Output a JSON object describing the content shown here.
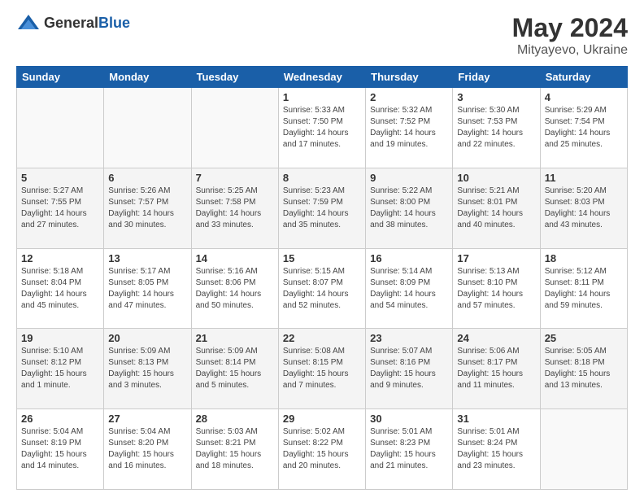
{
  "header": {
    "logo": {
      "general": "General",
      "blue": "Blue"
    },
    "title": "May 2024",
    "location": "Mityayevo, Ukraine"
  },
  "days_of_week": [
    "Sunday",
    "Monday",
    "Tuesday",
    "Wednesday",
    "Thursday",
    "Friday",
    "Saturday"
  ],
  "weeks": [
    [
      {
        "day": "",
        "info": ""
      },
      {
        "day": "",
        "info": ""
      },
      {
        "day": "",
        "info": ""
      },
      {
        "day": "1",
        "info": "Sunrise: 5:33 AM\nSunset: 7:50 PM\nDaylight: 14 hours\nand 17 minutes."
      },
      {
        "day": "2",
        "info": "Sunrise: 5:32 AM\nSunset: 7:52 PM\nDaylight: 14 hours\nand 19 minutes."
      },
      {
        "day": "3",
        "info": "Sunrise: 5:30 AM\nSunset: 7:53 PM\nDaylight: 14 hours\nand 22 minutes."
      },
      {
        "day": "4",
        "info": "Sunrise: 5:29 AM\nSunset: 7:54 PM\nDaylight: 14 hours\nand 25 minutes."
      }
    ],
    [
      {
        "day": "5",
        "info": "Sunrise: 5:27 AM\nSunset: 7:55 PM\nDaylight: 14 hours\nand 27 minutes."
      },
      {
        "day": "6",
        "info": "Sunrise: 5:26 AM\nSunset: 7:57 PM\nDaylight: 14 hours\nand 30 minutes."
      },
      {
        "day": "7",
        "info": "Sunrise: 5:25 AM\nSunset: 7:58 PM\nDaylight: 14 hours\nand 33 minutes."
      },
      {
        "day": "8",
        "info": "Sunrise: 5:23 AM\nSunset: 7:59 PM\nDaylight: 14 hours\nand 35 minutes."
      },
      {
        "day": "9",
        "info": "Sunrise: 5:22 AM\nSunset: 8:00 PM\nDaylight: 14 hours\nand 38 minutes."
      },
      {
        "day": "10",
        "info": "Sunrise: 5:21 AM\nSunset: 8:01 PM\nDaylight: 14 hours\nand 40 minutes."
      },
      {
        "day": "11",
        "info": "Sunrise: 5:20 AM\nSunset: 8:03 PM\nDaylight: 14 hours\nand 43 minutes."
      }
    ],
    [
      {
        "day": "12",
        "info": "Sunrise: 5:18 AM\nSunset: 8:04 PM\nDaylight: 14 hours\nand 45 minutes."
      },
      {
        "day": "13",
        "info": "Sunrise: 5:17 AM\nSunset: 8:05 PM\nDaylight: 14 hours\nand 47 minutes."
      },
      {
        "day": "14",
        "info": "Sunrise: 5:16 AM\nSunset: 8:06 PM\nDaylight: 14 hours\nand 50 minutes."
      },
      {
        "day": "15",
        "info": "Sunrise: 5:15 AM\nSunset: 8:07 PM\nDaylight: 14 hours\nand 52 minutes."
      },
      {
        "day": "16",
        "info": "Sunrise: 5:14 AM\nSunset: 8:09 PM\nDaylight: 14 hours\nand 54 minutes."
      },
      {
        "day": "17",
        "info": "Sunrise: 5:13 AM\nSunset: 8:10 PM\nDaylight: 14 hours\nand 57 minutes."
      },
      {
        "day": "18",
        "info": "Sunrise: 5:12 AM\nSunset: 8:11 PM\nDaylight: 14 hours\nand 59 minutes."
      }
    ],
    [
      {
        "day": "19",
        "info": "Sunrise: 5:10 AM\nSunset: 8:12 PM\nDaylight: 15 hours\nand 1 minute."
      },
      {
        "day": "20",
        "info": "Sunrise: 5:09 AM\nSunset: 8:13 PM\nDaylight: 15 hours\nand 3 minutes."
      },
      {
        "day": "21",
        "info": "Sunrise: 5:09 AM\nSunset: 8:14 PM\nDaylight: 15 hours\nand 5 minutes."
      },
      {
        "day": "22",
        "info": "Sunrise: 5:08 AM\nSunset: 8:15 PM\nDaylight: 15 hours\nand 7 minutes."
      },
      {
        "day": "23",
        "info": "Sunrise: 5:07 AM\nSunset: 8:16 PM\nDaylight: 15 hours\nand 9 minutes."
      },
      {
        "day": "24",
        "info": "Sunrise: 5:06 AM\nSunset: 8:17 PM\nDaylight: 15 hours\nand 11 minutes."
      },
      {
        "day": "25",
        "info": "Sunrise: 5:05 AM\nSunset: 8:18 PM\nDaylight: 15 hours\nand 13 minutes."
      }
    ],
    [
      {
        "day": "26",
        "info": "Sunrise: 5:04 AM\nSunset: 8:19 PM\nDaylight: 15 hours\nand 14 minutes."
      },
      {
        "day": "27",
        "info": "Sunrise: 5:04 AM\nSunset: 8:20 PM\nDaylight: 15 hours\nand 16 minutes."
      },
      {
        "day": "28",
        "info": "Sunrise: 5:03 AM\nSunset: 8:21 PM\nDaylight: 15 hours\nand 18 minutes."
      },
      {
        "day": "29",
        "info": "Sunrise: 5:02 AM\nSunset: 8:22 PM\nDaylight: 15 hours\nand 20 minutes."
      },
      {
        "day": "30",
        "info": "Sunrise: 5:01 AM\nSunset: 8:23 PM\nDaylight: 15 hours\nand 21 minutes."
      },
      {
        "day": "31",
        "info": "Sunrise: 5:01 AM\nSunset: 8:24 PM\nDaylight: 15 hours\nand 23 minutes."
      },
      {
        "day": "",
        "info": ""
      }
    ]
  ]
}
